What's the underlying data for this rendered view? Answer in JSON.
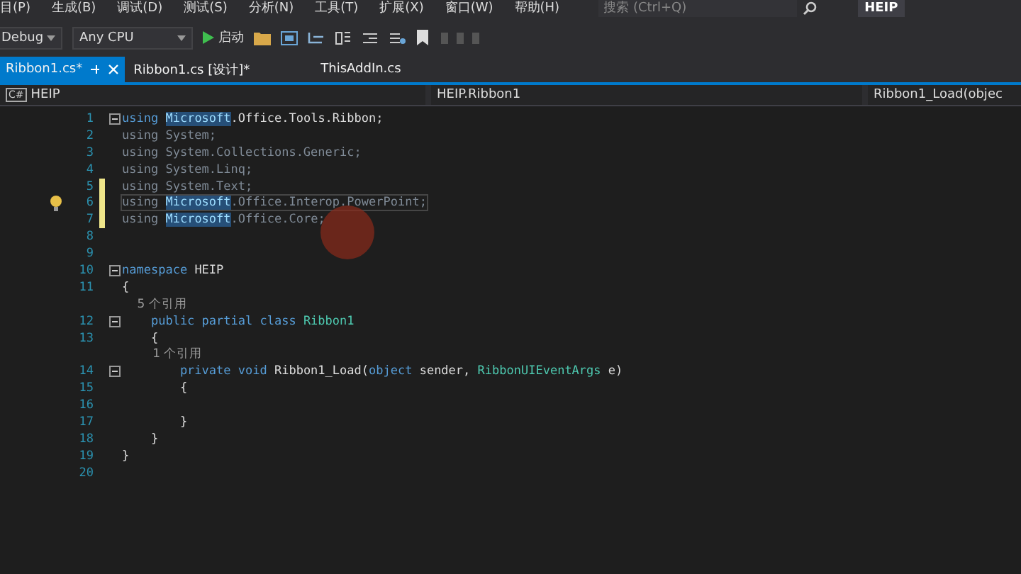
{
  "menu": [
    "目(P)",
    "生成(B)",
    "调试(D)",
    "测试(S)",
    "分析(N)",
    "工具(T)",
    "扩展(X)",
    "窗口(W)",
    "帮助(H)"
  ],
  "search": {
    "placeholder": "搜索 (Ctrl+Q)"
  },
  "solution_name": "HEIP",
  "toolbar": {
    "configuration": "Debug",
    "platform": "Any CPU",
    "start": "启动"
  },
  "tabs": [
    {
      "label": "Ribbon1.cs*",
      "selected": true
    },
    {
      "label": "Ribbon1.cs [设计]*",
      "selected": false
    },
    {
      "label": "ThisAddIn.cs",
      "selected": false
    }
  ],
  "nav_bar": {
    "project_badge": "C#",
    "project": "HEIP",
    "class": "HEIP.Ribbon1",
    "member": "Ribbon1_Load(objec"
  },
  "lines": [
    {
      "kind": "code",
      "number": "1",
      "fold": true,
      "changed": false,
      "lightbulb": false,
      "current": false,
      "tokens": [
        {
          "kind": "kw",
          "text": "using "
        },
        {
          "kind": "selected",
          "text": "Microsoft"
        },
        {
          "kind": "plain",
          "text": ".Office.Tools.Ribbon;"
        }
      ]
    },
    {
      "kind": "code",
      "number": "2",
      "fold": false,
      "changed": false,
      "lightbulb": false,
      "current": false,
      "tokens": [
        {
          "kind": "dim",
          "text": "using System;"
        }
      ]
    },
    {
      "kind": "code",
      "number": "3",
      "fold": false,
      "changed": false,
      "lightbulb": false,
      "current": false,
      "tokens": [
        {
          "kind": "dim",
          "text": "using System.Collections.Generic;"
        }
      ]
    },
    {
      "kind": "code",
      "number": "4",
      "fold": false,
      "changed": false,
      "lightbulb": false,
      "current": false,
      "tokens": [
        {
          "kind": "dim",
          "text": "using System.Linq;"
        }
      ]
    },
    {
      "kind": "code",
      "number": "5",
      "fold": false,
      "changed": true,
      "lightbulb": false,
      "current": false,
      "tokens": [
        {
          "kind": "dim",
          "text": "using System.Text;"
        }
      ]
    },
    {
      "kind": "code",
      "number": "6",
      "fold": false,
      "changed": true,
      "lightbulb": true,
      "current": true,
      "tokens": [
        {
          "kind": "dim",
          "text": "using "
        },
        {
          "kind": "selected",
          "text": "Microsoft"
        },
        {
          "kind": "dim",
          "text": ".Office.Interop.PowerPoint;"
        }
      ]
    },
    {
      "kind": "code",
      "number": "7",
      "fold": false,
      "changed": true,
      "lightbulb": false,
      "current": false,
      "tokens": [
        {
          "kind": "dim",
          "text": "using "
        },
        {
          "kind": "selected",
          "text": "Microsoft"
        },
        {
          "kind": "dim",
          "text": ".Office.Core;"
        }
      ]
    },
    {
      "kind": "code",
      "number": "8",
      "fold": false,
      "changed": false,
      "lightbulb": false,
      "current": false
    },
    {
      "kind": "code",
      "number": "9",
      "fold": false,
      "changed": false,
      "lightbulb": false,
      "current": false
    },
    {
      "kind": "code",
      "number": "10",
      "fold": true,
      "changed": false,
      "lightbulb": false,
      "current": false,
      "tokens": [
        {
          "kind": "kw",
          "text": "namespace "
        },
        {
          "kind": "plain",
          "text": "HEIP"
        }
      ]
    },
    {
      "kind": "code",
      "number": "11",
      "fold": false,
      "changed": false,
      "lightbulb": false,
      "current": false,
      "tokens": [
        {
          "kind": "plain",
          "text": "{"
        }
      ]
    },
    {
      "kind": "codelens",
      "text": "    5 个引用"
    },
    {
      "kind": "code",
      "number": "12",
      "fold": true,
      "changed": false,
      "lightbulb": false,
      "current": false,
      "tokens": [
        {
          "kind": "kw",
          "text": "    public partial class "
        },
        {
          "kind": "type",
          "text": "Ribbon1"
        }
      ]
    },
    {
      "kind": "code",
      "number": "13",
      "fold": false,
      "changed": false,
      "lightbulb": false,
      "current": false,
      "tokens": [
        {
          "kind": "plain",
          "text": "    {"
        }
      ]
    },
    {
      "kind": "codelens",
      "text": "        1 个引用"
    },
    {
      "kind": "code",
      "number": "14",
      "fold": true,
      "changed": false,
      "lightbulb": false,
      "current": false,
      "tokens": [
        {
          "kind": "kw",
          "text": "        private void "
        },
        {
          "kind": "plain",
          "text": "Ribbon1_Load("
        },
        {
          "kind": "kw",
          "text": "object "
        },
        {
          "kind": "plain",
          "text": "sender, "
        },
        {
          "kind": "type",
          "text": "RibbonUIEventArgs "
        },
        {
          "kind": "plain",
          "text": "e)"
        }
      ]
    },
    {
      "kind": "code",
      "number": "15",
      "fold": false,
      "changed": false,
      "lightbulb": false,
      "current": false,
      "tokens": [
        {
          "kind": "plain",
          "text": "        {"
        }
      ]
    },
    {
      "kind": "code",
      "number": "16",
      "fold": false,
      "changed": false,
      "lightbulb": false,
      "current": false
    },
    {
      "kind": "code",
      "number": "17",
      "fold": false,
      "changed": false,
      "lightbulb": false,
      "current": false,
      "tokens": [
        {
          "kind": "plain",
          "text": "        }"
        }
      ]
    },
    {
      "kind": "code",
      "number": "18",
      "fold": false,
      "changed": false,
      "lightbulb": false,
      "current": false,
      "tokens": [
        {
          "kind": "plain",
          "text": "    }"
        }
      ]
    },
    {
      "kind": "code",
      "number": "19",
      "fold": false,
      "changed": false,
      "lightbulb": false,
      "current": false,
      "tokens": [
        {
          "kind": "plain",
          "text": "}"
        }
      ]
    },
    {
      "kind": "code",
      "number": "20",
      "fold": false,
      "changed": false,
      "lightbulb": false,
      "current": false
    }
  ]
}
